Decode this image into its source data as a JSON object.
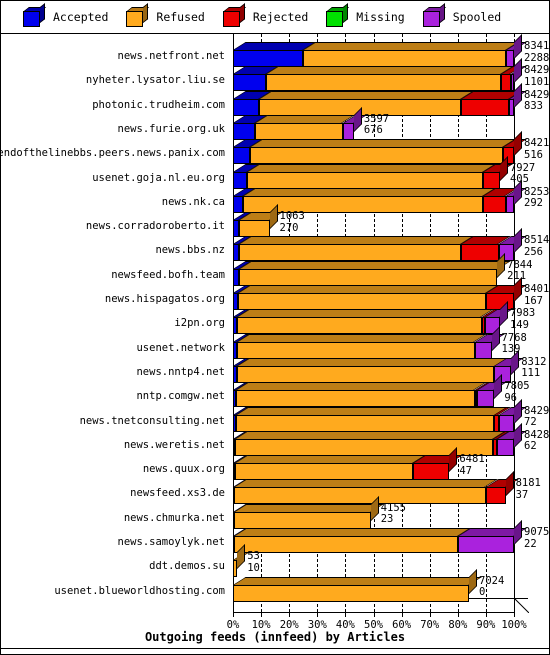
{
  "legend": {
    "items": [
      {
        "label": "Accepted",
        "color": "#0000EE",
        "icon": "cube-icon"
      },
      {
        "label": "Refused",
        "color": "#FFAA1E",
        "icon": "cube-icon"
      },
      {
        "label": "Rejected",
        "color": "#EE0000",
        "icon": "cube-icon"
      },
      {
        "label": "Missing",
        "color": "#00E000",
        "icon": "cube-icon"
      },
      {
        "label": "Spooled",
        "color": "#AA22DD",
        "icon": "cube-icon"
      }
    ]
  },
  "axis": {
    "xlabel": "",
    "ticks": [
      "0%",
      "10%",
      "20%",
      "30%",
      "40%",
      "50%",
      "60%",
      "70%",
      "80%",
      "90%",
      "100%"
    ],
    "xlim": [
      0,
      100
    ]
  },
  "title": "Outgoing feeds (innfeed) by Articles",
  "chart_data": {
    "type": "bar",
    "subtype": "stacked-horizontal-percent-3d",
    "title": "Outgoing feeds (innfeed) by Articles",
    "xlabel": "",
    "ylabel": "",
    "xlim": [
      0,
      100
    ],
    "xticks": [
      0,
      10,
      20,
      30,
      40,
      50,
      60,
      70,
      80,
      90,
      100
    ],
    "xticklabels": [
      "0%",
      "10%",
      "20%",
      "30%",
      "40%",
      "50%",
      "60%",
      "70%",
      "80%",
      "90%",
      "100%"
    ],
    "grid": true,
    "legend": [
      "Accepted",
      "Refused",
      "Rejected",
      "Missing",
      "Spooled"
    ],
    "legend_position": "top",
    "series_colors": {
      "Accepted": "#0000EE",
      "Refused": "#FFAA1E",
      "Rejected": "#EE0000",
      "Missing": "#00E000",
      "Spooled": "#AA22DD"
    },
    "categories": [
      "news.netfront.net",
      "nyheter.lysator.liu.se",
      "photonic.trudheim.com",
      "news.furie.org.uk",
      "endofthelinebbs.peers.news.panix.com",
      "usenet.goja.nl.eu.org",
      "news.nk.ca",
      "news.corradoroberto.it",
      "news.bbs.nz",
      "newsfeed.bofh.team",
      "news.hispagatos.org",
      "i2pn.org",
      "usenet.network",
      "news.nntp4.net",
      "nntp.comgw.net",
      "news.tnetconsulting.net",
      "news.weretis.net",
      "news.quux.org",
      "newsfeed.xs3.de",
      "news.chmurka.net",
      "news.samoylyk.net",
      "ddt.demos.su",
      "usenet.blueworldhosting.com"
    ],
    "bar_labels_top": [
      8341,
      8429,
      8429,
      3597,
      8421,
      7927,
      8253,
      1063,
      8514,
      7844,
      8401,
      7983,
      7768,
      8312,
      7805,
      8429,
      8428,
      6481,
      8181,
      4155,
      9075,
      53,
      7024
    ],
    "bar_labels_bottom": [
      2288,
      1101,
      833,
      676,
      516,
      405,
      292,
      270,
      256,
      211,
      167,
      149,
      139,
      111,
      96,
      72,
      62,
      47,
      37,
      23,
      22,
      10,
      0
    ],
    "bar_total_pct": [
      100,
      100,
      100,
      43,
      100,
      95,
      100,
      13,
      100,
      94,
      100,
      95,
      92,
      99,
      93,
      100,
      100,
      77,
      97,
      49,
      100,
      1.5,
      84
    ],
    "rows": [
      {
        "category": "news.netfront.net",
        "total": 8341,
        "secondary": 2288,
        "segments": [
          {
            "name": "Accepted",
            "pct": 25.0
          },
          {
            "name": "Refused",
            "pct": 72.3
          },
          {
            "name": "Spooled",
            "pct": 2.7
          }
        ]
      },
      {
        "category": "nyheter.lysator.liu.se",
        "total": 8429,
        "secondary": 1101,
        "segments": [
          {
            "name": "Accepted",
            "pct": 11.9
          },
          {
            "name": "Refused",
            "pct": 83.6
          },
          {
            "name": "Rejected",
            "pct": 3.3
          },
          {
            "name": "Spooled",
            "pct": 1.2
          }
        ]
      },
      {
        "category": "photonic.trudheim.com",
        "total": 8429,
        "secondary": 833,
        "segments": [
          {
            "name": "Accepted",
            "pct": 9.3
          },
          {
            "name": "Refused",
            "pct": 72.0
          },
          {
            "name": "Rejected",
            "pct": 17.0
          },
          {
            "name": "Spooled",
            "pct": 1.7
          }
        ]
      },
      {
        "category": "news.furie.org.uk",
        "total": 3597,
        "secondary": 676,
        "segments": [
          {
            "name": "Accepted",
            "pct": 8.0
          },
          {
            "name": "Refused",
            "pct": 31.0
          },
          {
            "name": "Spooled",
            "pct": 4.0
          }
        ]
      },
      {
        "category": "endofthelinebbs.peers.news.panix.com",
        "total": 8421,
        "secondary": 516,
        "segments": [
          {
            "name": "Accepted",
            "pct": 6.0
          },
          {
            "name": "Refused",
            "pct": 90.2
          },
          {
            "name": "Rejected",
            "pct": 3.8
          }
        ]
      },
      {
        "category": "usenet.goja.nl.eu.org",
        "total": 7927,
        "secondary": 405,
        "segments": [
          {
            "name": "Accepted",
            "pct": 5.1
          },
          {
            "name": "Refused",
            "pct": 84.0
          },
          {
            "name": "Rejected",
            "pct": 5.9
          }
        ]
      },
      {
        "category": "news.nk.ca",
        "total": 8253,
        "secondary": 292,
        "segments": [
          {
            "name": "Accepted",
            "pct": 3.5
          },
          {
            "name": "Refused",
            "pct": 85.5
          },
          {
            "name": "Rejected",
            "pct": 8.0
          },
          {
            "name": "Spooled",
            "pct": 3.0
          }
        ]
      },
      {
        "category": "news.corradoroberto.it",
        "total": 1063,
        "secondary": 270,
        "segments": [
          {
            "name": "Accepted",
            "pct": 2.0
          },
          {
            "name": "Refused",
            "pct": 11.0
          }
        ]
      },
      {
        "category": "news.bbs.nz",
        "total": 8514,
        "secondary": 256,
        "segments": [
          {
            "name": "Accepted",
            "pct": 2.2
          },
          {
            "name": "Refused",
            "pct": 79.0
          },
          {
            "name": "Rejected",
            "pct": 13.3
          },
          {
            "name": "Spooled",
            "pct": 5.5
          }
        ]
      },
      {
        "category": "newsfeed.bofh.team",
        "total": 7844,
        "secondary": 211,
        "segments": [
          {
            "name": "Accepted",
            "pct": 2.0
          },
          {
            "name": "Refused",
            "pct": 92.0
          }
        ]
      },
      {
        "category": "news.hispagatos.org",
        "total": 8401,
        "secondary": 167,
        "segments": [
          {
            "name": "Accepted",
            "pct": 1.9
          },
          {
            "name": "Refused",
            "pct": 88.1
          },
          {
            "name": "Rejected",
            "pct": 10.0
          }
        ]
      },
      {
        "category": "i2pn.org",
        "total": 7983,
        "secondary": 149,
        "segments": [
          {
            "name": "Accepted",
            "pct": 1.5
          },
          {
            "name": "Refused",
            "pct": 87.0
          },
          {
            "name": "Rejected",
            "pct": 1.3
          },
          {
            "name": "Spooled",
            "pct": 5.2
          }
        ]
      },
      {
        "category": "usenet.network",
        "total": 7768,
        "secondary": 139,
        "segments": [
          {
            "name": "Accepted",
            "pct": 1.6
          },
          {
            "name": "Refused",
            "pct": 84.4
          },
          {
            "name": "Spooled",
            "pct": 6.0
          }
        ]
      },
      {
        "category": "news.nntp4.net",
        "total": 8312,
        "secondary": 111,
        "segments": [
          {
            "name": "Accepted",
            "pct": 1.3
          },
          {
            "name": "Refused",
            "pct": 91.7
          },
          {
            "name": "Spooled",
            "pct": 6.0
          }
        ]
      },
      {
        "category": "nntp.comgw.net",
        "total": 7805,
        "secondary": 96,
        "segments": [
          {
            "name": "Accepted",
            "pct": 1.2
          },
          {
            "name": "Refused",
            "pct": 84.8
          },
          {
            "name": "Rejected",
            "pct": 1.0
          },
          {
            "name": "Spooled",
            "pct": 6.0
          }
        ]
      },
      {
        "category": "news.tnetconsulting.net",
        "total": 8429,
        "secondary": 72,
        "segments": [
          {
            "name": "Accepted",
            "pct": 0.9
          },
          {
            "name": "Refused",
            "pct": 92.1
          },
          {
            "name": "Rejected",
            "pct": 1.5
          },
          {
            "name": "Spooled",
            "pct": 5.5
          }
        ]
      },
      {
        "category": "news.weretis.net",
        "total": 8428,
        "secondary": 62,
        "segments": [
          {
            "name": "Accepted",
            "pct": 0.8
          },
          {
            "name": "Refused",
            "pct": 91.7
          },
          {
            "name": "Rejected",
            "pct": 1.5
          },
          {
            "name": "Spooled",
            "pct": 6.0
          }
        ]
      },
      {
        "category": "news.quux.org",
        "total": 6481,
        "secondary": 47,
        "segments": [
          {
            "name": "Accepted",
            "pct": 0.7
          },
          {
            "name": "Refused",
            "pct": 63.3
          },
          {
            "name": "Rejected",
            "pct": 13.0
          }
        ]
      },
      {
        "category": "newsfeed.xs3.de",
        "total": 8181,
        "secondary": 37,
        "segments": [
          {
            "name": "Accepted",
            "pct": 0.5
          },
          {
            "name": "Refused",
            "pct": 89.5
          },
          {
            "name": "Rejected",
            "pct": 7.0
          }
        ]
      },
      {
        "category": "news.chmurka.net",
        "total": 4155,
        "secondary": 23,
        "segments": [
          {
            "name": "Accepted",
            "pct": 0.4
          },
          {
            "name": "Refused",
            "pct": 48.6
          }
        ]
      },
      {
        "category": "news.samoylyk.net",
        "total": 9075,
        "secondary": 22,
        "segments": [
          {
            "name": "Accepted",
            "pct": 0.3
          },
          {
            "name": "Refused",
            "pct": 79.7
          },
          {
            "name": "Spooled",
            "pct": 20.0
          }
        ]
      },
      {
        "category": "ddt.demos.su",
        "total": 53,
        "secondary": 10,
        "segments": [
          {
            "name": "Refused",
            "pct": 1.5
          }
        ]
      },
      {
        "category": "usenet.blueworldhosting.com",
        "total": 7024,
        "secondary": 0,
        "segments": [
          {
            "name": "Refused",
            "pct": 84.0
          }
        ]
      }
    ]
  }
}
